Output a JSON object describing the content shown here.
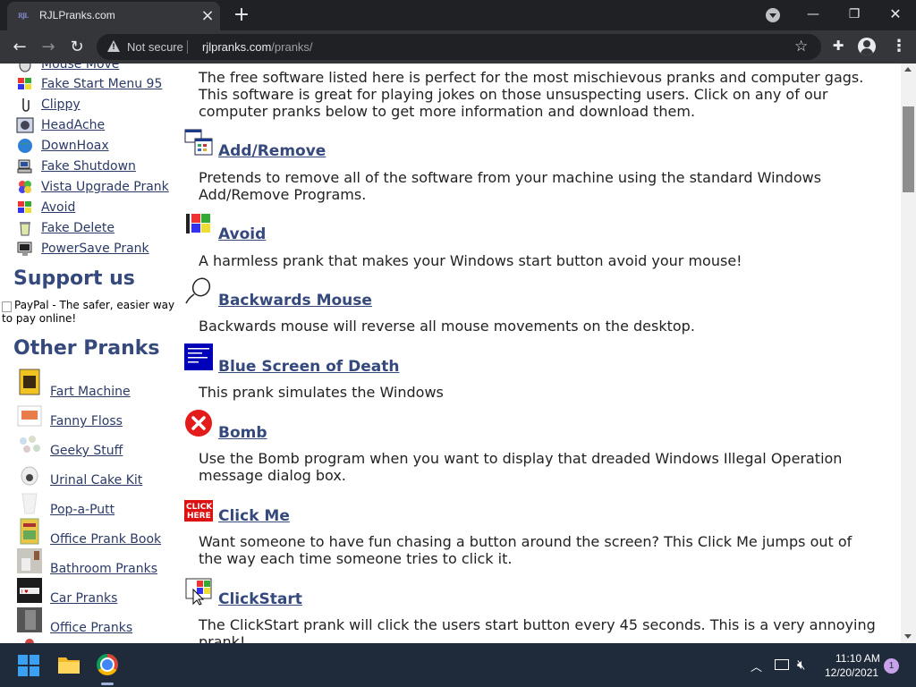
{
  "browser": {
    "tab_title": "RJLPranks.com",
    "tab_favicon_text": "RJL",
    "not_secure": "Not secure",
    "url_host": "rjlpranks.com",
    "url_path": "/pranks/",
    "window_controls": {
      "minimize": "—",
      "maximize": "❐",
      "close": "✕"
    }
  },
  "sidebar": {
    "prank_links": [
      {
        "label": "Mouse Move",
        "icon": "mouse-move-icon"
      },
      {
        "label": "Fake Start Menu 95",
        "icon": "windows-flag-icon"
      },
      {
        "label": "Clippy",
        "icon": "paperclip-icon"
      },
      {
        "label": "HeadAche",
        "icon": "headache-icon"
      },
      {
        "label": "DownHoax",
        "icon": "globe-icon"
      },
      {
        "label": "Fake Shutdown",
        "icon": "computer-icon"
      },
      {
        "label": "Vista Upgrade Prank",
        "icon": "vista-icon"
      },
      {
        "label": "Avoid",
        "icon": "windows-flag-icon"
      },
      {
        "label": "Fake Delete",
        "icon": "recycle-bin-icon"
      },
      {
        "label": "PowerSave Prank",
        "icon": "monitor-icon"
      }
    ],
    "support_heading": "Support us",
    "paypal_alt": "PayPal - The safer, easier way to pay online!",
    "other_heading": "Other Pranks",
    "other_pranks": [
      {
        "label": "Fart Machine",
        "icon": "fart-machine-thumb"
      },
      {
        "label": "Fanny Floss",
        "icon": "fanny-floss-thumb"
      },
      {
        "label": "Geeky Stuff",
        "icon": "geeky-stuff-thumb"
      },
      {
        "label": "Urinal Cake Kit",
        "icon": "urinal-cake-thumb"
      },
      {
        "label": "Pop-a-Putt",
        "icon": "pop-a-putt-thumb"
      },
      {
        "label": "Office Prank Book",
        "icon": "office-book-thumb"
      },
      {
        "label": "Bathroom Pranks",
        "icon": "bathroom-thumb"
      },
      {
        "label": "Car Pranks",
        "icon": "car-thumb"
      },
      {
        "label": "Office Pranks",
        "icon": "office-thumb"
      }
    ]
  },
  "main": {
    "intro": "The free software listed here is perfect for the most mischievous pranks and computer gags. This software is great for playing jokes on those unsuspecting users. Click on any of our computer pranks below to get more information and download them.",
    "pranks": [
      {
        "title": "Add/Remove",
        "desc": "Pretends to remove all of the software from your machine using the standard Windows Add/Remove Programs.",
        "icon": "add-remove-icon"
      },
      {
        "title": "Avoid",
        "desc": "A harmless prank that makes your Windows start button avoid your mouse!",
        "icon": "windows-flag-icon"
      },
      {
        "title": "Backwards Mouse",
        "desc": "Backwards mouse will reverse all mouse movements on the desktop.",
        "icon": "mouse-icon"
      },
      {
        "title": "Blue Screen of Death",
        "desc": "This prank simulates the Windows",
        "icon": "blue-screen-icon"
      },
      {
        "title": "Bomb",
        "desc": "Use the Bomb program when you want to display that dreaded Windows Illegal Operation message dialog box.",
        "icon": "error-x-icon"
      },
      {
        "title": "Click Me",
        "desc": "Want someone to have fun chasing a button around the screen? This Click Me jumps out of the way each time someone tries to click it.",
        "icon": "click-here-icon"
      },
      {
        "title": "ClickStart",
        "desc": "The ClickStart prank will click the users start button every 45 seconds. This is a very annoying prank!",
        "icon": "click-start-icon"
      }
    ]
  },
  "taskbar": {
    "time": "11:10 AM",
    "date": "12/20/2021",
    "notification_count": "1"
  },
  "colors": {
    "link": "#35497d",
    "chrome_dark": "#202124",
    "toolbar": "#35363a",
    "taskbar": "#1f2b3a"
  }
}
